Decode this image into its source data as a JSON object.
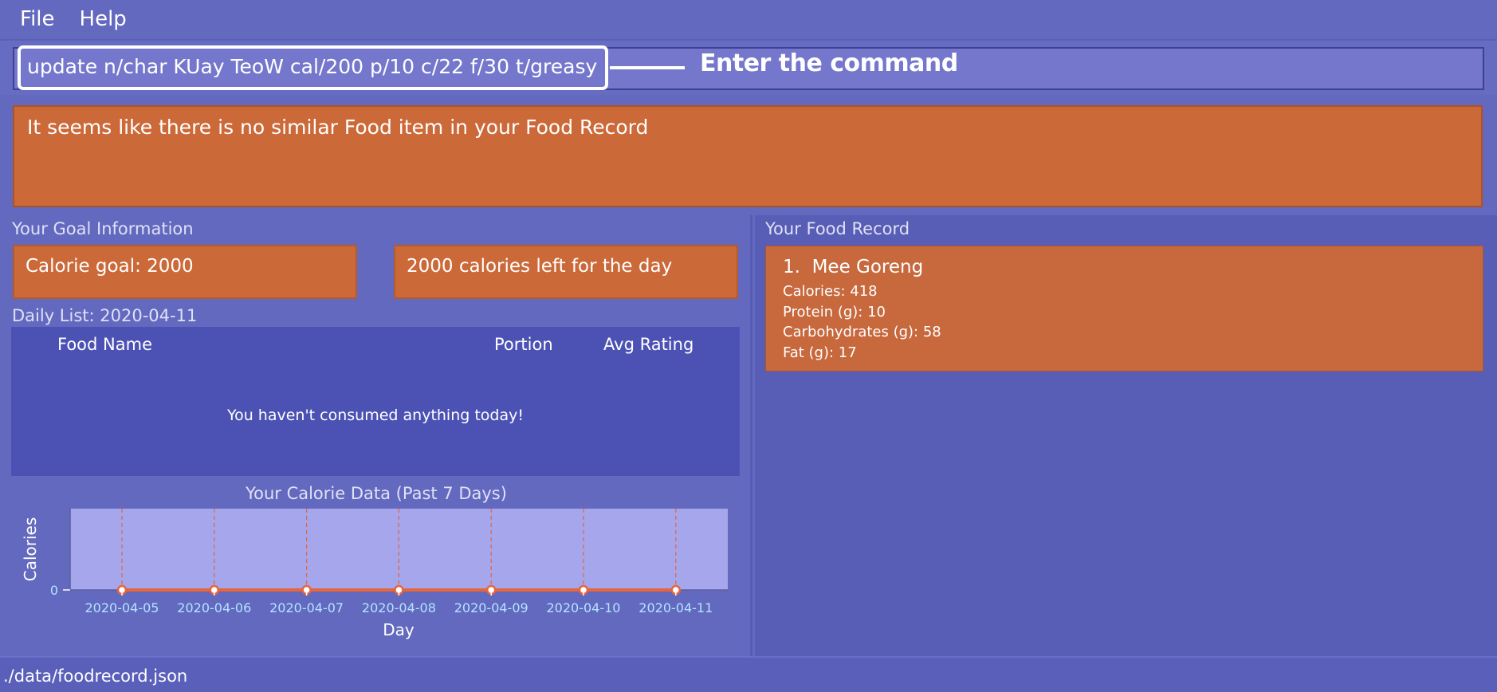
{
  "menu": {
    "file": "File",
    "help": "Help"
  },
  "command": {
    "value": "update n/char KUay TeoW cal/200 p/10 c/22 f/30 t/greasy",
    "callout": "Enter the command"
  },
  "result": {
    "message": "It seems like there is no similar Food item in your Food Record"
  },
  "goal": {
    "section_title": "Your Goal Information",
    "calorie_goal": "Calorie goal: 2000",
    "calories_left": "2000 calories left for the day"
  },
  "daily_list": {
    "title": "Daily List: 2020-04-11",
    "columns": [
      "Food Name",
      "Portion",
      "Avg Rating"
    ],
    "empty_message": "You haven't consumed anything today!"
  },
  "food_record": {
    "section_title": "Your Food Record",
    "items": [
      {
        "index": "1.",
        "name": "Mee Goreng",
        "calories": "Calories: 418",
        "protein": "Protein (g): 10",
        "carbs": "Carbohydrates (g): 58",
        "fat": "Fat (g): 17"
      }
    ]
  },
  "chart_data": {
    "type": "line",
    "title": "Your Calorie Data (Past 7 Days)",
    "xlabel": "Day",
    "ylabel": "Calories",
    "categories": [
      "2020-04-05",
      "2020-04-06",
      "2020-04-07",
      "2020-04-08",
      "2020-04-09",
      "2020-04-10",
      "2020-04-11"
    ],
    "series": [
      {
        "values": [
          0,
          0,
          0,
          0,
          0,
          0,
          0
        ]
      }
    ],
    "yticks": [
      "0"
    ],
    "colors": {
      "plot_bg": "#a5a6ec",
      "line": "#e8643a",
      "tick_label": "#b4e3ff"
    }
  },
  "status": {
    "path": "./data/foodrecord.json"
  }
}
